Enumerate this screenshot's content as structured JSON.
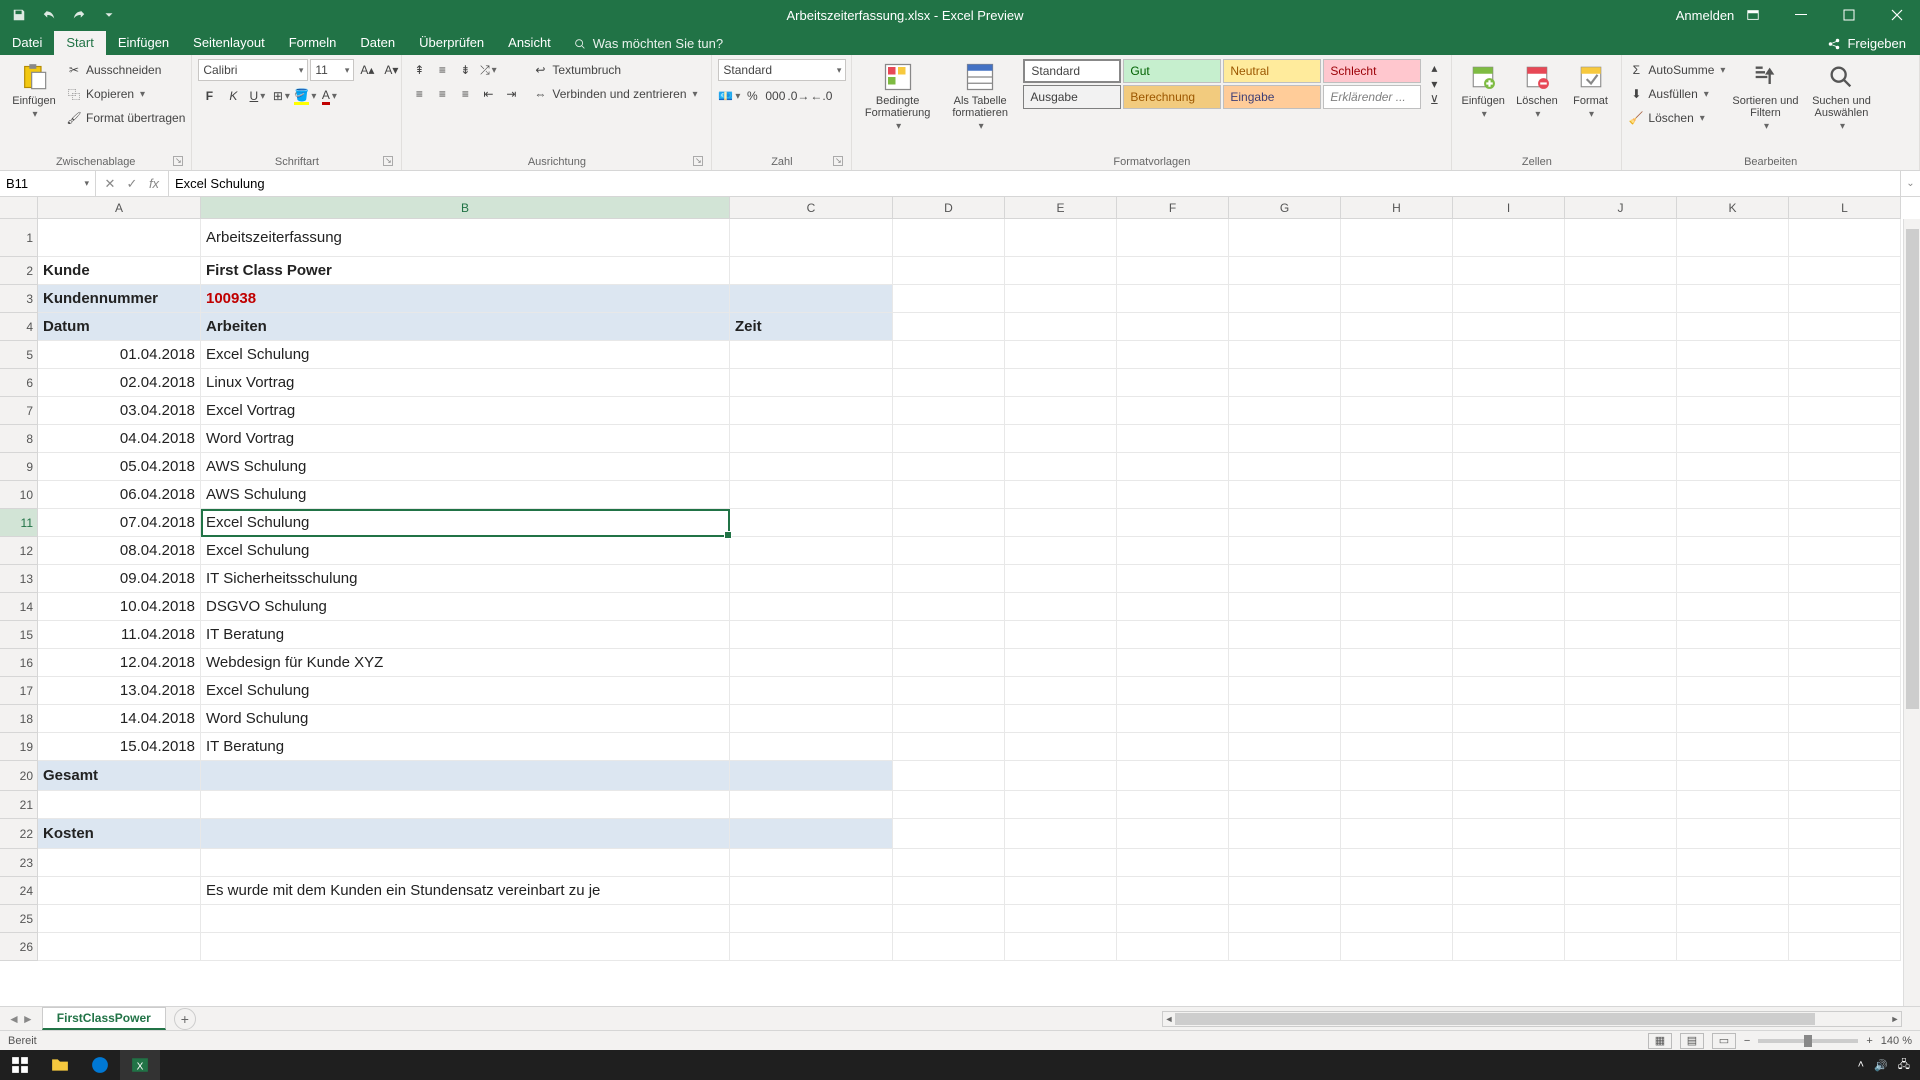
{
  "titlebar": {
    "title": "Arbeitszeiterfassung.xlsx - Excel Preview",
    "signin": "Anmelden"
  },
  "tabs": {
    "file": "Datei",
    "home": "Start",
    "insert": "Einfügen",
    "layout": "Seitenlayout",
    "formulas": "Formeln",
    "data": "Daten",
    "review": "Überprüfen",
    "view": "Ansicht",
    "tell": "Was möchten Sie tun?",
    "share": "Freigeben"
  },
  "ribbon": {
    "clipboard": {
      "paste": "Einfügen",
      "cut": "Ausschneiden",
      "copy": "Kopieren",
      "format": "Format übertragen",
      "label": "Zwischenablage"
    },
    "font": {
      "name": "Calibri",
      "size": "11",
      "label": "Schriftart"
    },
    "align": {
      "wrap": "Textumbruch",
      "merge": "Verbinden und zentrieren",
      "label": "Ausrichtung"
    },
    "number": {
      "format": "Standard",
      "label": "Zahl"
    },
    "styles": {
      "cond": "Bedingte Formatierung",
      "table": "Als Tabelle formatieren",
      "s1": "Standard",
      "s2": "Gut",
      "s3": "Neutral",
      "s4": "Schlecht",
      "s5": "Ausgabe",
      "s6": "Berechnung",
      "s7": "Eingabe",
      "s8": "Erklärender ...",
      "label": "Formatvorlagen"
    },
    "cells": {
      "insert": "Einfügen",
      "delete": "Löschen",
      "format": "Format",
      "label": "Zellen"
    },
    "editing": {
      "sum": "AutoSumme",
      "fill": "Ausfüllen",
      "clear": "Löschen",
      "sort": "Sortieren und Filtern",
      "find": "Suchen und Auswählen",
      "label": "Bearbeiten"
    }
  },
  "formula": {
    "namebox": "B11",
    "value": "Excel Schulung"
  },
  "cols": [
    "A",
    "B",
    "C",
    "D",
    "E",
    "F",
    "G",
    "H",
    "I",
    "J",
    "K",
    "L"
  ],
  "sheet": {
    "title": "Arbeitszeiterfassung",
    "kunde_lbl": "Kunde",
    "kunde_val": "First Class Power",
    "knr_lbl": "Kundennummer",
    "knr_val": "100938",
    "h_datum": "Datum",
    "h_arbeiten": "Arbeiten",
    "h_zeit": "Zeit",
    "rows": [
      {
        "d": "01.04.2018",
        "a": "Excel Schulung"
      },
      {
        "d": "02.04.2018",
        "a": "Linux Vortrag"
      },
      {
        "d": "03.04.2018",
        "a": "Excel Vortrag"
      },
      {
        "d": "04.04.2018",
        "a": "Word Vortrag"
      },
      {
        "d": "05.04.2018",
        "a": "AWS Schulung"
      },
      {
        "d": "06.04.2018",
        "a": "AWS Schulung"
      },
      {
        "d": "07.04.2018",
        "a": "Excel Schulung"
      },
      {
        "d": "08.04.2018",
        "a": "Excel Schulung"
      },
      {
        "d": "09.04.2018",
        "a": "IT Sicherheitsschulung"
      },
      {
        "d": "10.04.2018",
        "a": "DSGVO Schulung"
      },
      {
        "d": "11.04.2018",
        "a": "IT Beratung"
      },
      {
        "d": "12.04.2018",
        "a": "Webdesign für Kunde XYZ"
      },
      {
        "d": "13.04.2018",
        "a": "Excel Schulung"
      },
      {
        "d": "14.04.2018",
        "a": "Word Schulung"
      },
      {
        "d": "15.04.2018",
        "a": "IT Beratung"
      }
    ],
    "gesamt": "Gesamt",
    "kosten": "Kosten",
    "note": "Es wurde mit dem Kunden ein Stundensatz vereinbart zu je"
  },
  "tab_name": "FirstClassPower",
  "status": {
    "ready": "Bereit",
    "zoom": "140 %"
  }
}
